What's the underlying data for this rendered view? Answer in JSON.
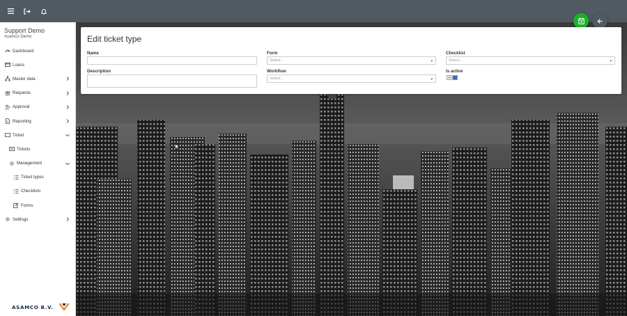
{
  "topbar": {
    "icons": [
      "menu-icon",
      "logout-icon",
      "bell-icon"
    ]
  },
  "sidebar": {
    "org_name": "Support Demo",
    "org_sub": "Asamco Demo",
    "items": [
      {
        "label": "Dashboard",
        "icon": "dashboard-icon"
      },
      {
        "label": "Loans",
        "icon": "loans-icon"
      },
      {
        "label": "Master data",
        "icon": "sitemap-icon"
      },
      {
        "label": "Requests",
        "icon": "users-icon"
      },
      {
        "label": "Approval",
        "icon": "user-check-icon"
      },
      {
        "label": "Reporting",
        "icon": "report-icon"
      },
      {
        "label": "Ticket",
        "icon": "ticket-icon"
      },
      {
        "label": "Tickets",
        "icon": "tickets-icon"
      },
      {
        "label": "Management",
        "icon": "gear-icon"
      },
      {
        "label": "Ticket types",
        "icon": "list-icon"
      },
      {
        "label": "Checklists",
        "icon": "list-icon"
      },
      {
        "label": "Forms",
        "icon": "edit-icon"
      },
      {
        "label": "Settings",
        "icon": "gear-icon"
      }
    ],
    "logo_text": "ASAMCO B.V."
  },
  "actions": {
    "save_icon": "save-icon",
    "back_icon": "arrow-left-icon"
  },
  "form": {
    "title": "Edit ticket type",
    "name_label": "Name",
    "name_value": "",
    "description_label": "Description",
    "description_value": "",
    "form_label": "Form",
    "form_placeholder": "Select...",
    "workflow_label": "Workflow",
    "workflow_placeholder": "Select...",
    "checklist_label": "Checklist",
    "checklist_placeholder": "Select...",
    "is_active_label": "Is active",
    "toggle_text": "ON"
  },
  "colors": {
    "topbar": "#4f5b61",
    "save_button": "#1bb32a",
    "toggle_accent": "#3a6fb5"
  }
}
